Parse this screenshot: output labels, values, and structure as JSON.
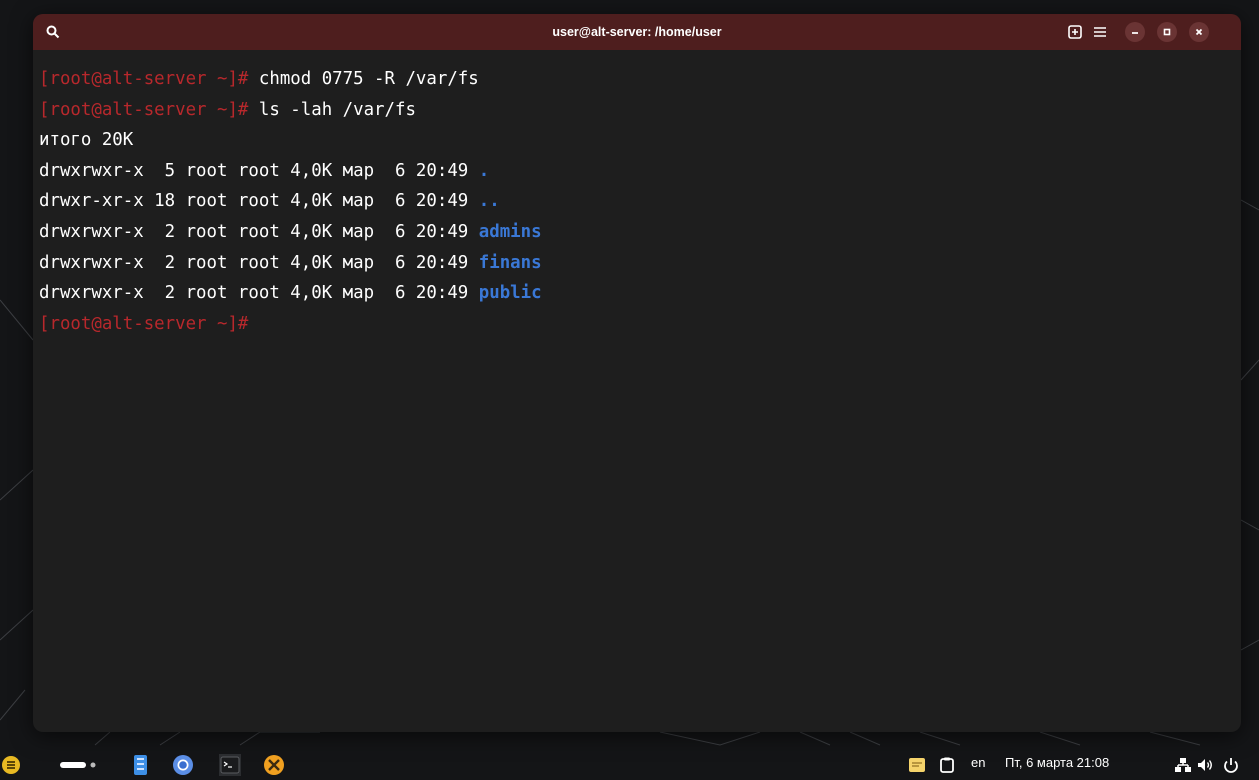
{
  "window": {
    "title": "user@alt-server: /home/user"
  },
  "terminal": {
    "lines": [
      {
        "prompt": "[root@alt-server ~]#",
        "text": " chmod 0775 -R /var/fs",
        "dir": ""
      },
      {
        "prompt": "[root@alt-server ~]#",
        "text": " ls -lah /var/fs",
        "dir": ""
      },
      {
        "prompt": "",
        "text": "итого 20K",
        "dir": ""
      },
      {
        "prompt": "",
        "text": "drwxrwxr-x  5 root root 4,0K мар  6 20:49 ",
        "dir": "."
      },
      {
        "prompt": "",
        "text": "drwxr-xr-x 18 root root 4,0K мар  6 20:49 ",
        "dir": ".."
      },
      {
        "prompt": "",
        "text": "drwxrwxr-x  2 root root 4,0K мар  6 20:49 ",
        "dir": "admins"
      },
      {
        "prompt": "",
        "text": "drwxrwxr-x  2 root root 4,0K мар  6 20:49 ",
        "dir": "finans"
      },
      {
        "prompt": "",
        "text": "drwxrwxr-x  2 root root 4,0K мар  6 20:49 ",
        "dir": "public"
      },
      {
        "prompt": "[root@alt-server ~]#",
        "text": "",
        "dir": ""
      }
    ]
  },
  "tray": {
    "keyboard_layout": "en",
    "datetime": "Пт, 6 марта 21:08"
  },
  "colors": {
    "titlebar": "#4e1e1e",
    "prompt": "#b8282c",
    "directory": "#3a78d6",
    "terminal_bg": "#1e1e1e"
  },
  "icons": {
    "titlebar": [
      "search-icon",
      "new-tab-icon",
      "menu-icon",
      "minimize-icon",
      "maximize-icon",
      "close-icon"
    ],
    "taskbar": [
      "app-menu-icon",
      "workspace-indicator-icon",
      "file-manager-icon",
      "chromium-icon",
      "terminal-icon",
      "settings-tools-icon"
    ],
    "tray": [
      "notes-icon",
      "clipboard-icon",
      "network-icon",
      "volume-icon",
      "power-icon"
    ]
  }
}
